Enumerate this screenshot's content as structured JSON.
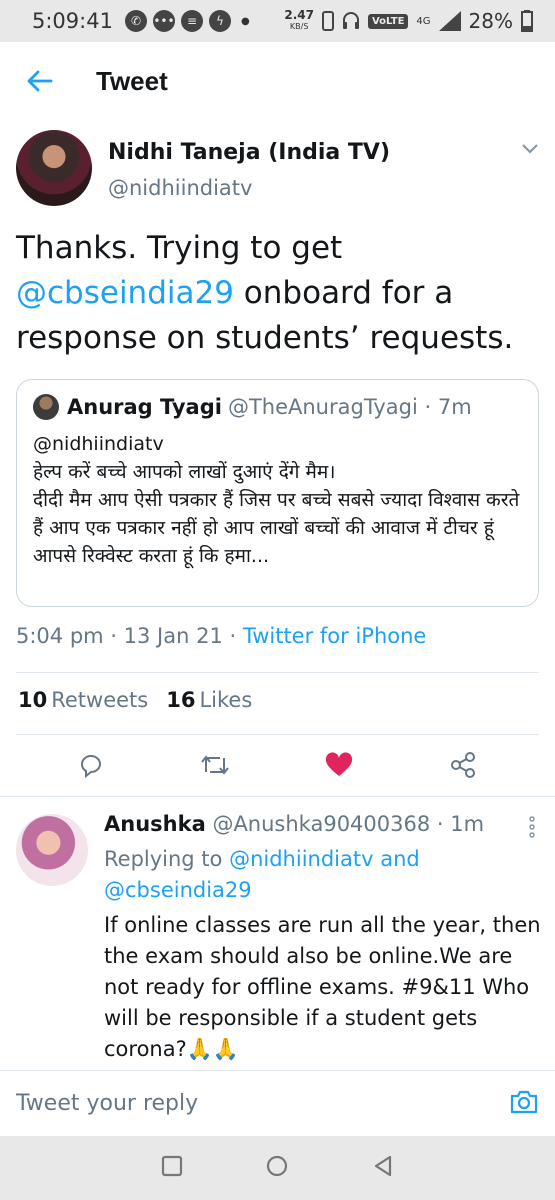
{
  "status_bar": {
    "time": "5:09:41",
    "net_speed": "2.47",
    "net_unit": "KB/S",
    "volte": "VoLTE",
    "network": "4G",
    "battery": "28%"
  },
  "header": {
    "title": "Tweet"
  },
  "tweet": {
    "author_name": "Nidhi Taneja (India TV)",
    "author_handle": "@nidhiindiatv",
    "text_part1": "Thanks. Trying to get ",
    "text_mention": "@cbseindia29",
    "text_part2": " onboard for a response on students’ requests.",
    "quote": {
      "name": "Anurag Tyagi",
      "handle_time": "@TheAnuragTyagi · 7m",
      "line1": "@nidhiindiatv",
      "line2": "हेल्प करें बच्चे आपको लाखों दुआएं देंगे मैम।",
      "line3": "दीदी मैम आप ऐसी पत्रकार हैं जिस पर बच्चे सबसे ज्यादा विश्वास करते हैं आप एक पत्रकार नहीं हो आप लाखों बच्चों की आवाज में टीचर हूं आपसे रिक्वेस्ट करता हूं कि हमा..."
    },
    "timestamp": "5:04 pm · 13 Jan 21 · ",
    "source": "Twitter for iPhone",
    "retweets_count": "10",
    "retweets_label": "Retweets",
    "likes_count": "16",
    "likes_label": "Likes"
  },
  "reply": {
    "name": "Anushka",
    "handle_time": "@Anushka90400368 · 1m",
    "replying_prefix": "Replying to ",
    "replying_to1": "@nidhiindiatv",
    "replying_and": " and",
    "replying_to2": "@cbseindia29",
    "text": "If online classes are run all the year, then the exam should also be online.We are not ready for offline exams. #9&11 Who will be responsible if a student gets corona?🙏🙏"
  },
  "composer": {
    "placeholder": "Tweet your reply"
  },
  "colors": {
    "accent": "#1da1f2",
    "like": "#e0245e",
    "muted": "#657786"
  },
  "icons": [
    "whatsapp-icon",
    "chat-icon",
    "message-icon",
    "messenger-icon",
    "phone-icon",
    "headset-icon",
    "signal-icon",
    "battery-icon",
    "back-arrow-icon",
    "chevron-down-icon",
    "reply-icon",
    "retweet-icon",
    "like-icon",
    "share-icon",
    "more-vertical-icon",
    "camera-icon",
    "recents-icon",
    "home-icon",
    "back-icon"
  ]
}
